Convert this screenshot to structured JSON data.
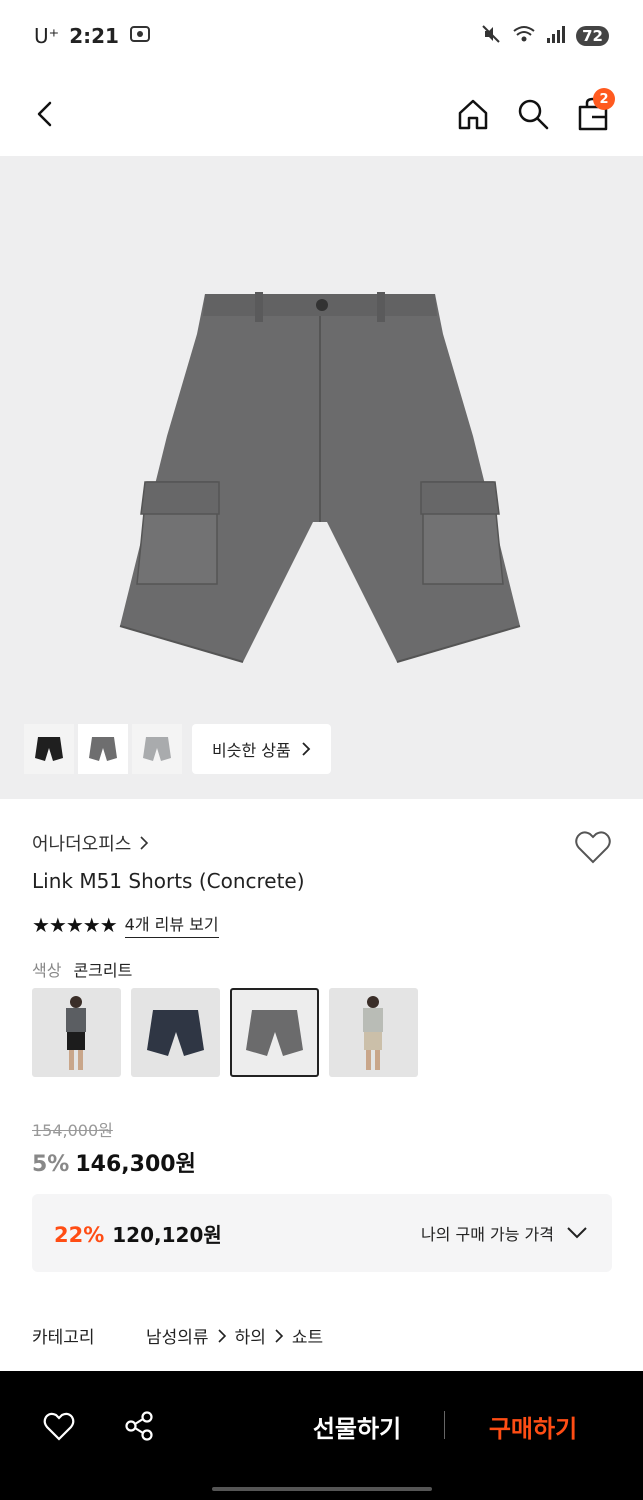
{
  "status": {
    "carrier": "U⁺",
    "time": "2:21",
    "battery": "72"
  },
  "nav": {
    "cart_count": "2"
  },
  "gallery": {
    "similar_label": "비슷한 상품"
  },
  "product": {
    "brand": "어나더오피스",
    "name": "Link M51 Shorts (Concrete)",
    "stars": "★★★★★",
    "review_link": "4개 리뷰 보기",
    "color_label": "색상",
    "color_value": "콘크리트"
  },
  "price": {
    "original": "154,000원",
    "discount": "5%",
    "sale": "146,300원",
    "best_discount": "22%",
    "best_price": "120,120원",
    "best_label": "나의 구매 가능 가격"
  },
  "category": {
    "label": "카테고리",
    "path": [
      "남성의류",
      "하의",
      "쇼트"
    ]
  },
  "bottom": {
    "gift_label": "선물하기",
    "buy_label": "구매하기"
  },
  "colors": {
    "accent": "#ff4d14",
    "badge": "#ff5a1f",
    "product_gray": "#6b6b6c"
  }
}
